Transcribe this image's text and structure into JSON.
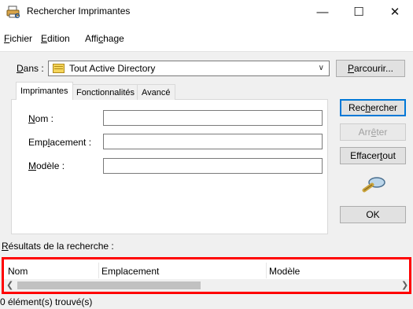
{
  "window": {
    "title": "Rechercher Imprimantes",
    "minimize": "—",
    "maximize": "☐",
    "close": "✕"
  },
  "menu": {
    "items": [
      {
        "label_pre": "",
        "label_u": "F",
        "label_post": "ichier"
      },
      {
        "label_pre": "",
        "label_u": "E",
        "label_post": "dition"
      },
      {
        "label_pre": "Affi",
        "label_u": "c",
        "label_post": "hage"
      }
    ]
  },
  "scope": {
    "label_u": "D",
    "label_post": "ans :",
    "value": "Tout Active Directory"
  },
  "buttons": {
    "browse_u": "P",
    "browse_post": "arcourir...",
    "search_pre": "Rec",
    "search_u": "h",
    "search_post": "ercher",
    "stop_pre": "Arr",
    "stop_u": "ê",
    "stop_post": "ter",
    "clear_pre": "Effacer ",
    "clear_u": "t",
    "clear_post": "out",
    "ok": "OK"
  },
  "tabs": [
    {
      "label": "Imprimantes"
    },
    {
      "label": "Fonctionnalités"
    },
    {
      "label": "Avancé"
    }
  ],
  "fields": {
    "name_u": "N",
    "name_post": "om :",
    "location_pre": "Emp",
    "location_u": "l",
    "location_post": "acement :",
    "model_u": "M",
    "model_post": "odèle :"
  },
  "results": {
    "label_u": "R",
    "label_post": "ésultats de la recherche :",
    "columns": [
      "Nom",
      "Emplacement",
      "Modèle"
    ]
  },
  "status": {
    "text": "0 élément(s) trouvé(s)"
  },
  "colors": {
    "highlight_border": "#ff0000",
    "focus_blue": "#0078d7"
  }
}
